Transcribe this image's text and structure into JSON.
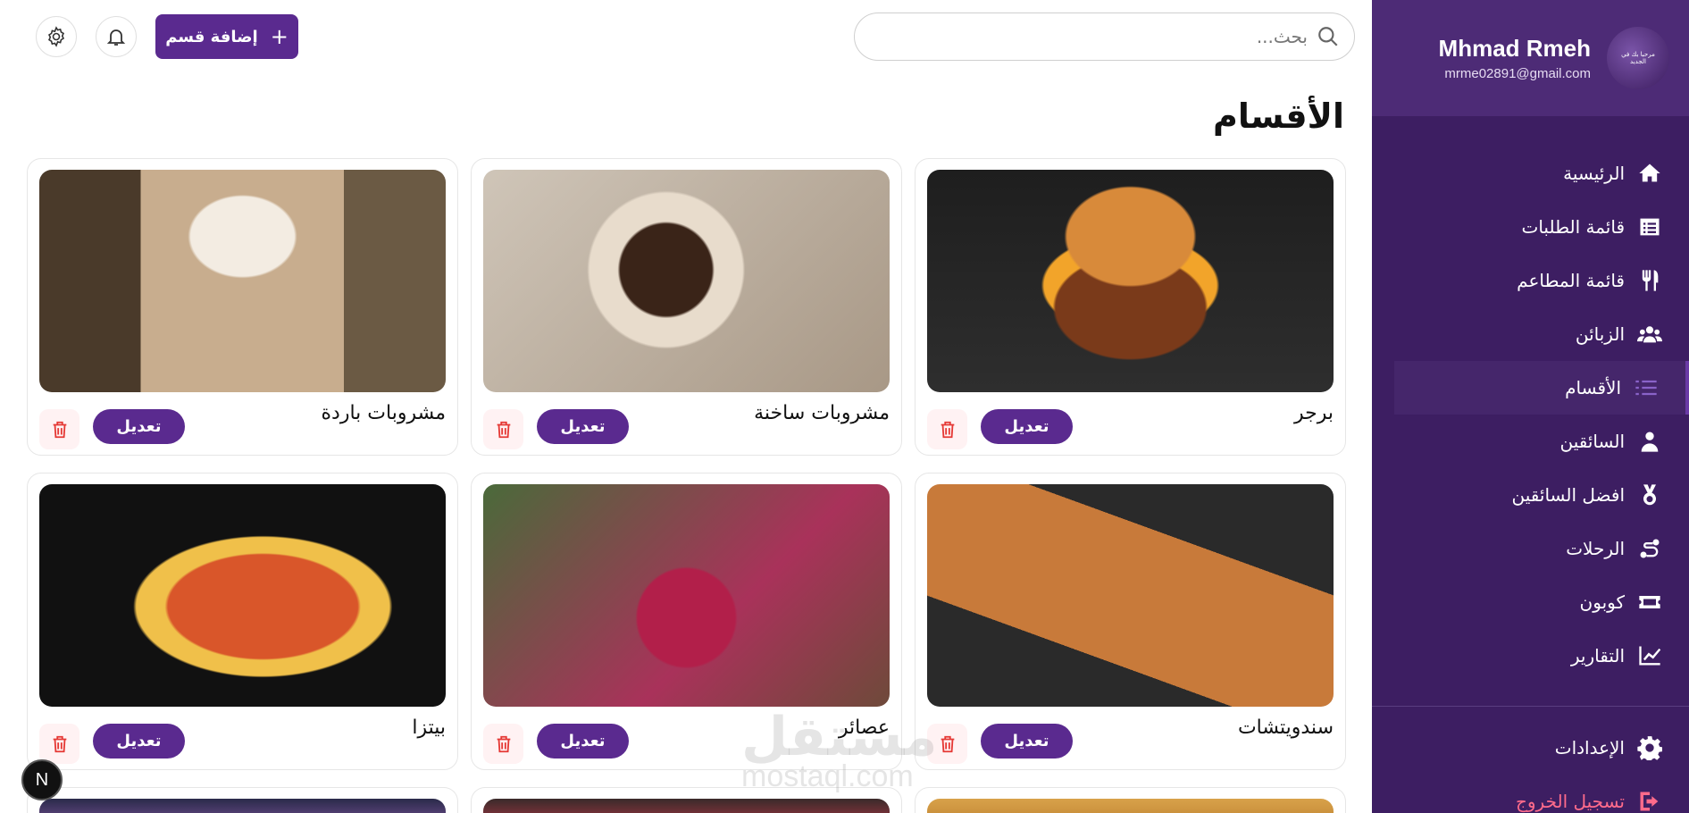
{
  "profile": {
    "name": "Mhmad Rmeh",
    "email": "mrme02891@gmail.com",
    "avatar_text": "مرحبا بك في الجديد"
  },
  "nav": {
    "items": [
      {
        "label": "الرئيسية",
        "icon": "home-icon"
      },
      {
        "label": "قائمة الطلبات",
        "icon": "list-icon"
      },
      {
        "label": "قائمة المطاعم",
        "icon": "utensils-icon"
      },
      {
        "label": "الزبائن",
        "icon": "users-icon"
      },
      {
        "label": "الأقسام",
        "icon": "categories-icon",
        "active": true
      },
      {
        "label": "السائقين",
        "icon": "driver-icon"
      },
      {
        "label": "افضل السائقين",
        "icon": "award-icon"
      },
      {
        "label": "الرحلات",
        "icon": "route-icon"
      },
      {
        "label": "كوبون",
        "icon": "ticket-icon"
      },
      {
        "label": "التقارير",
        "icon": "chart-icon"
      }
    ],
    "settings": "الإعدادات",
    "logout": "تسجيل الخروج"
  },
  "topbar": {
    "search_placeholder": "بحث...",
    "add_label": "إضافة قسم"
  },
  "page": {
    "title": "الأقسام"
  },
  "cards": [
    {
      "name": "برجر",
      "edit": "تعديل"
    },
    {
      "name": "مشروبات ساخنة",
      "edit": "تعديل"
    },
    {
      "name": "مشروبات باردة",
      "edit": "تعديل"
    },
    {
      "name": "سندويتشات",
      "edit": "تعديل"
    },
    {
      "name": "عصائر",
      "edit": "تعديل"
    },
    {
      "name": "بيتزا",
      "edit": "تعديل"
    }
  ],
  "watermark": {
    "main": "مستقل",
    "sub": "mostaql.com"
  },
  "badge": "N",
  "colors": {
    "primary": "#5a2a8f",
    "sidebar": "#3d1e62",
    "danger": "#e53935"
  }
}
